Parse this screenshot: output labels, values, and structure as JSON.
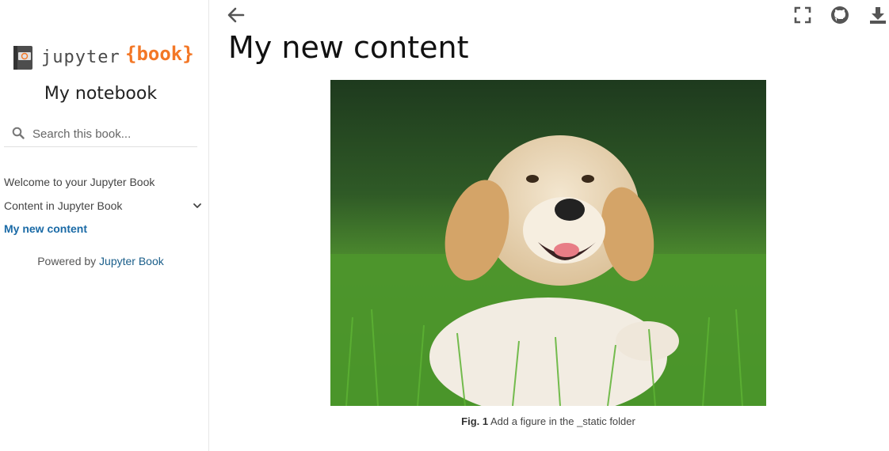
{
  "sidebar": {
    "logo": {
      "word_jupyter": "jupyter",
      "word_book": "{book}",
      "glyph_label": "jupyter"
    },
    "title": "My notebook",
    "search": {
      "placeholder": "Search this book..."
    },
    "nav": [
      {
        "label": "Welcome to your Jupyter Book",
        "active": false
      },
      {
        "label": "Content in Jupyter Book",
        "active": false,
        "expandable": true
      },
      {
        "label": "My new content",
        "active": true
      }
    ],
    "powered": {
      "prefix": "Powered by",
      "link": "Jupyter Book"
    }
  },
  "topbar": {
    "icons": [
      "back-arrow-icon",
      "fullscreen-icon",
      "github-icon",
      "download-icon"
    ]
  },
  "main": {
    "title": "My new content",
    "figure": {
      "label": "Fig. 1",
      "caption": "Add a figure in the _static folder"
    }
  },
  "colors": {
    "accent_orange": "#f37726",
    "link_blue": "#1a6aa6",
    "icon_gray": "#555555"
  }
}
